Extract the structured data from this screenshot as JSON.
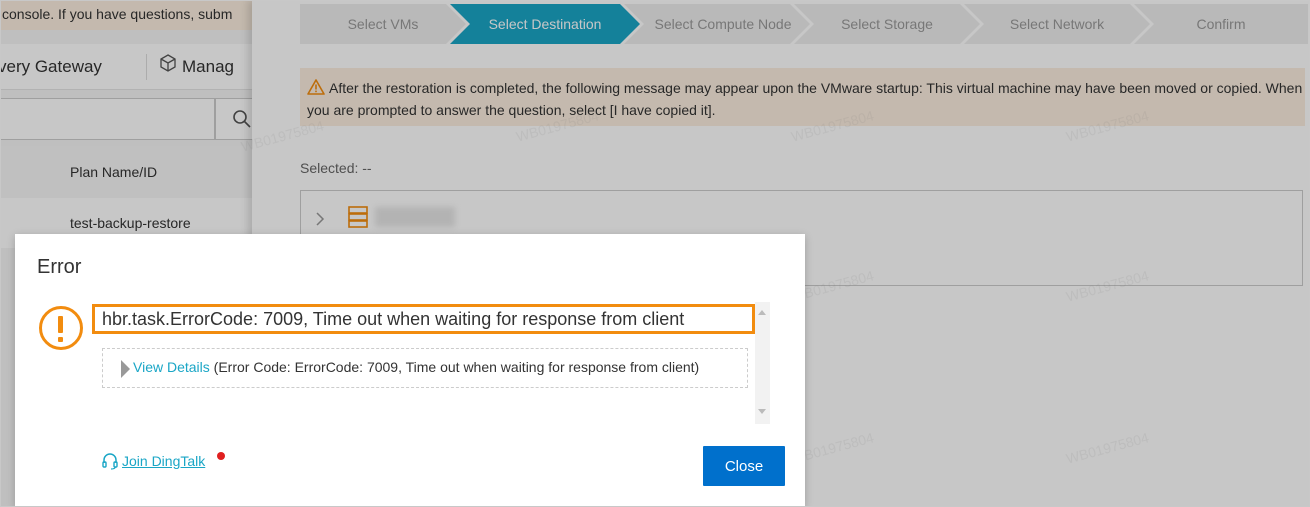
{
  "left_console": {
    "notice": "console. If you have questions, subm",
    "tabs": [
      "very Gateway",
      "Manag"
    ],
    "table_header": "Plan Name/ID",
    "rows": [
      "test-backup-restore"
    ]
  },
  "wizard": {
    "steps": [
      {
        "label": "Select VMs",
        "state": "inactive"
      },
      {
        "label": "Select Destination",
        "state": "active"
      },
      {
        "label": "Select Compute Node",
        "state": "inactive"
      },
      {
        "label": "Select Storage",
        "state": "inactive"
      },
      {
        "label": "Select Network",
        "state": "inactive"
      },
      {
        "label": "Confirm",
        "state": "inactive"
      }
    ]
  },
  "warning": {
    "text": "After the restoration is completed, the following message may appear upon the VMware startup: This virtual machine may have been moved or copied. When you are prompted to answer the question, select [I have copied it]."
  },
  "selection": {
    "label": "Selected: --"
  },
  "watermark": "WB01975804",
  "dialog": {
    "title": "Error",
    "message": "hbr.task.ErrorCode: 7009, Time out when waiting for response from client",
    "details_link": "View Details",
    "details_text": "(Error Code: ErrorCode: 7009, Time out when waiting for response from client)",
    "join_link": "Join DingTalk",
    "close_label": "Close"
  },
  "colors": {
    "accent": "#1aa6c6",
    "primary_button": "#0070cc",
    "error_highlight": "#f28c0f",
    "warning_bg": "#fbeedf"
  }
}
